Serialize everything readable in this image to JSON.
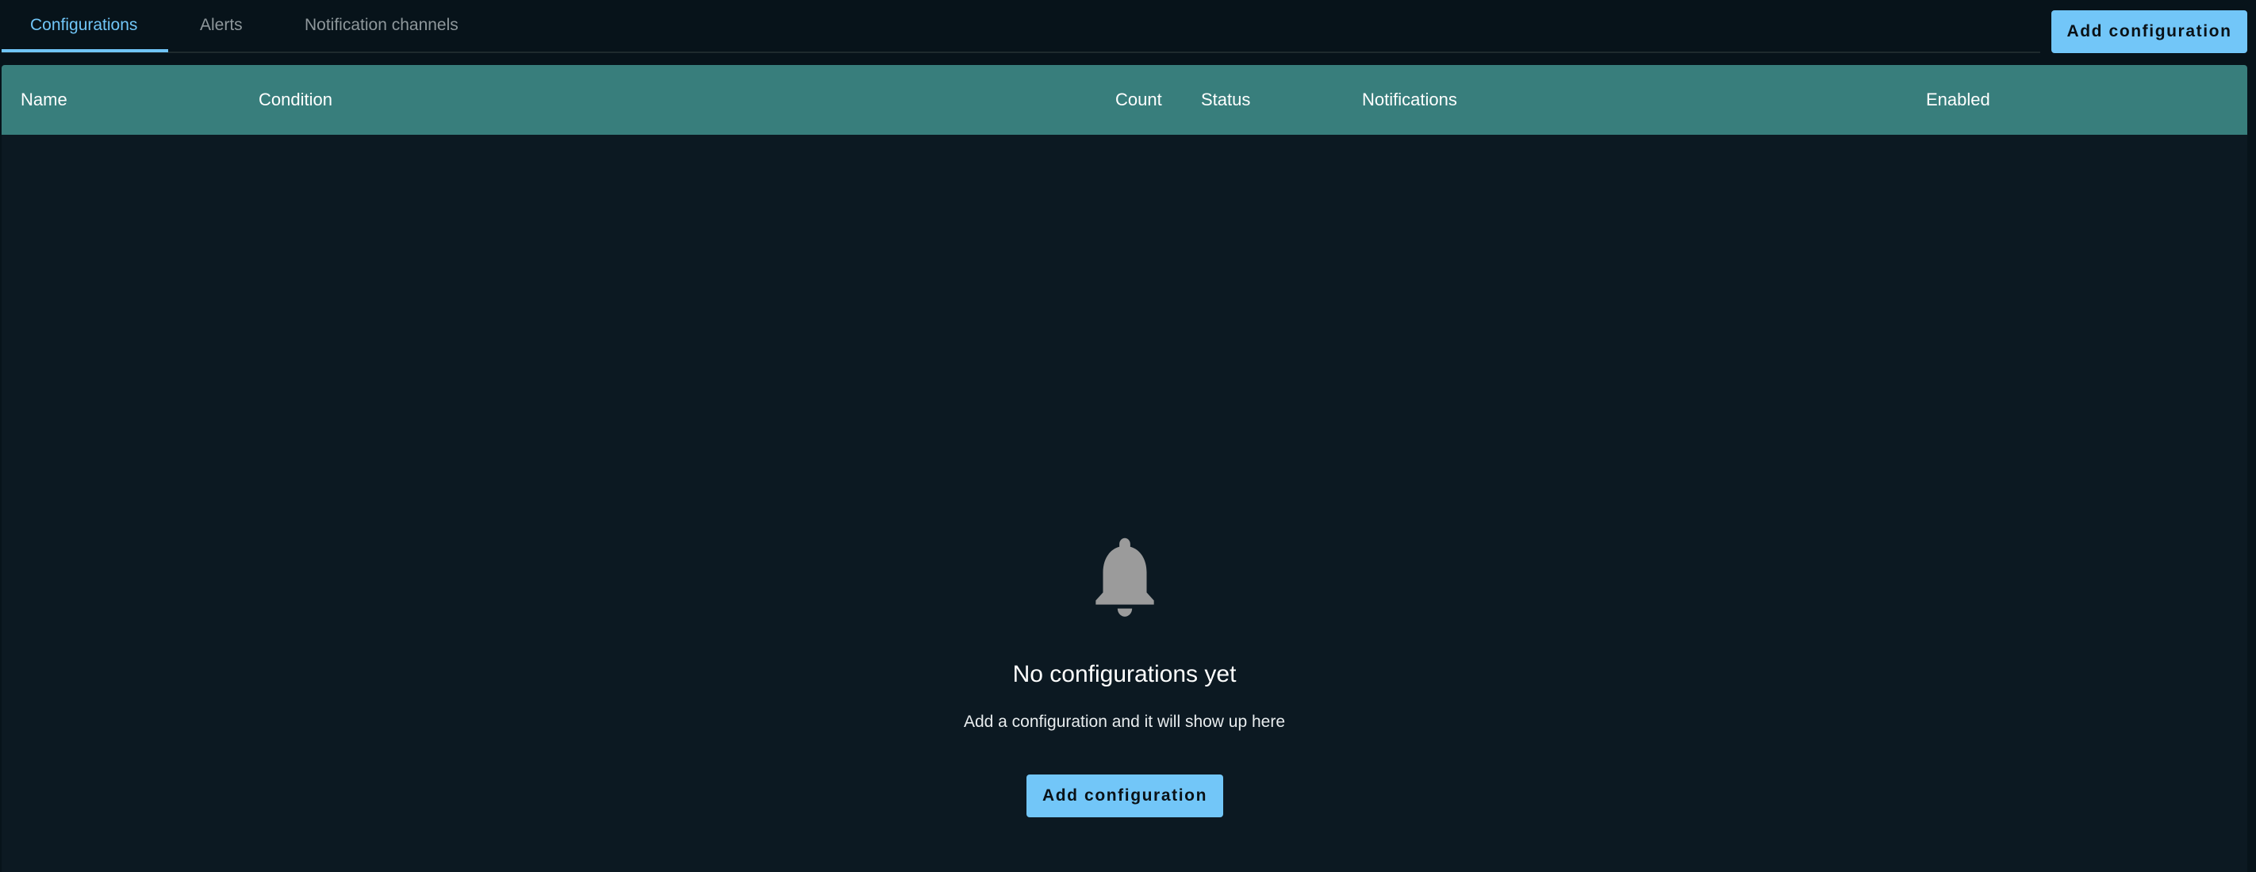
{
  "tabs": [
    {
      "label": "Configurations",
      "active": true
    },
    {
      "label": "Alerts",
      "active": false
    },
    {
      "label": "Notification channels",
      "active": false
    }
  ],
  "toolbar": {
    "add_configuration_label": "Add configuration"
  },
  "table": {
    "columns": [
      "Name",
      "Condition",
      "Count",
      "Status",
      "Notifications",
      "Enabled"
    ],
    "rows": []
  },
  "empty_state": {
    "icon": "bell-icon",
    "title": "No configurations yet",
    "subtitle": "Add a configuration and it will show up here",
    "button_label": "Add configuration"
  },
  "colors": {
    "accent": "#70c5f7",
    "table_header": "#387e7c",
    "background": "#07131a",
    "panel": "#0c1922",
    "icon": "#9b9b9b"
  }
}
